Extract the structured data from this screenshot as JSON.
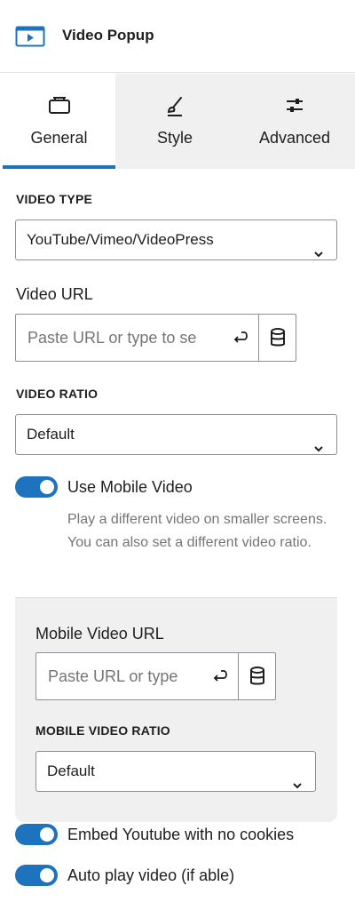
{
  "block": {
    "title": "Video Popup",
    "icon": "video-icon"
  },
  "tabs": [
    {
      "label": "General",
      "icon": "toolbox-icon"
    },
    {
      "label": "Style",
      "icon": "brush-icon"
    },
    {
      "label": "Advanced",
      "icon": "sliders-icon"
    }
  ],
  "video_type": {
    "label": "VIDEO TYPE",
    "value": "YouTube/Vimeo/VideoPress"
  },
  "video_url": {
    "label": "Video URL",
    "placeholder": "Paste URL or type to se"
  },
  "video_ratio": {
    "label": "VIDEO RATIO",
    "value": "Default"
  },
  "mobile_video_toggle": {
    "label": "Use Mobile Video",
    "help": "Play a different video on smaller screens. You can also set a different video ratio."
  },
  "mobile": {
    "url_label": "Mobile Video URL",
    "url_placeholder": "Paste URL or type",
    "ratio_label": "MOBILE VIDEO RATIO",
    "ratio_value": "Default"
  },
  "embed_toggle": {
    "label": "Embed Youtube with no cookies"
  },
  "autoplay_toggle": {
    "label": "Auto play video (if able)"
  },
  "colors": {
    "accent": "#1e73be",
    "panel": "#f0f0f0"
  }
}
